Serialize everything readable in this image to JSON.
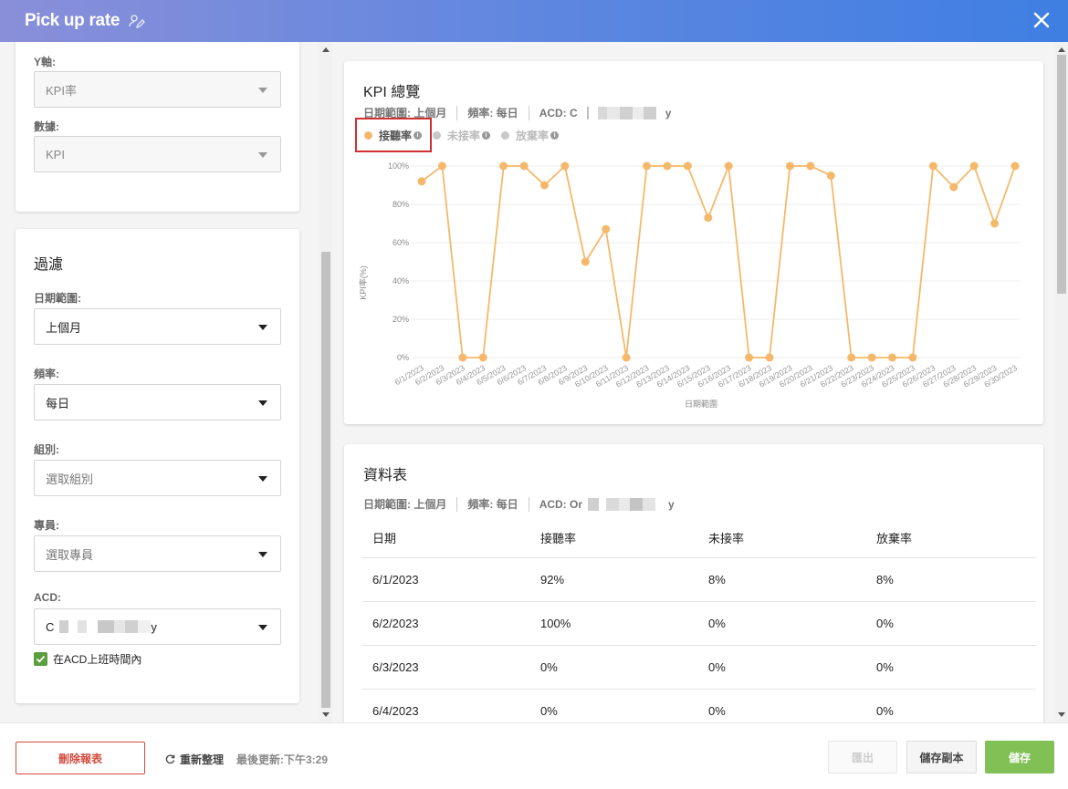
{
  "header": {
    "title": "Pick up rate"
  },
  "settings": {
    "y_axis_label": "Y軸:",
    "y_axis_value": "KPI率",
    "data_label": "數據:",
    "data_value": "KPI"
  },
  "filter": {
    "heading": "過濾",
    "date_range_label": "日期範圍:",
    "date_range_value": "上個月",
    "frequency_label": "頻率:",
    "frequency_value": "每日",
    "group_label": "組別:",
    "group_placeholder": "選取組別",
    "agent_label": "專員:",
    "agent_placeholder": "選取專員",
    "acd_label": "ACD:",
    "acd_value_start": "C",
    "acd_value_end": "y",
    "checkbox_label": "在ACD上班時間內",
    "checkbox_checked": true
  },
  "chart_card": {
    "title": "KPI 總覽",
    "meta_date": "日期範圍: 上個月",
    "meta_freq": "頻率: 每日",
    "meta_acd_prefix": "ACD: C",
    "meta_acd_suffix": "y",
    "legend": [
      {
        "label": "接聽率",
        "color": "#f5b86b",
        "active": true
      },
      {
        "label": "未接率",
        "color": "#c8c8c8",
        "active": false
      },
      {
        "label": "放棄率",
        "color": "#c8c8c8",
        "active": false
      }
    ]
  },
  "chart_data": {
    "type": "line",
    "title": "",
    "xlabel": "日期範圍",
    "ylabel": "KPI率(%)",
    "ylim": [
      0,
      100
    ],
    "yticks": [
      "0%",
      "20%",
      "40%",
      "60%",
      "80%",
      "100%"
    ],
    "color": "#f5b86b",
    "categories": [
      "6/1/2023",
      "6/2/2023",
      "6/3/2023",
      "6/4/2023",
      "6/5/2023",
      "6/6/2023",
      "6/7/2023",
      "6/8/2023",
      "6/9/2023",
      "6/10/2023",
      "6/11/2023",
      "6/12/2023",
      "6/13/2023",
      "6/14/2023",
      "6/15/2023",
      "6/16/2023",
      "6/17/2023",
      "6/18/2023",
      "6/19/2023",
      "6/20/2023",
      "6/21/2023",
      "6/22/2023",
      "6/23/2023",
      "6/24/2023",
      "6/25/2023",
      "6/26/2023",
      "6/27/2023",
      "6/28/2023",
      "6/29/2023",
      "6/30/2023"
    ],
    "series": [
      {
        "name": "接聽率",
        "values": [
          92,
          100,
          0,
          0,
          100,
          100,
          90,
          100,
          50,
          67,
          0,
          100,
          100,
          100,
          73,
          100,
          0,
          0,
          100,
          100,
          95,
          0,
          0,
          0,
          0,
          100,
          89,
          100,
          70,
          100
        ]
      }
    ]
  },
  "table_card": {
    "title": "資料表",
    "meta_date": "日期範圍: 上個月",
    "meta_freq": "頻率: 每日",
    "meta_acd_prefix": "ACD: Or",
    "meta_acd_suffix": "y",
    "columns": [
      "日期",
      "接聽率",
      "未接率",
      "放棄率"
    ],
    "rows": [
      [
        "6/1/2023",
        "92%",
        "8%",
        "8%"
      ],
      [
        "6/2/2023",
        "100%",
        "0%",
        "0%"
      ],
      [
        "6/3/2023",
        "0%",
        "0%",
        "0%"
      ],
      [
        "6/4/2023",
        "0%",
        "0%",
        "0%"
      ]
    ]
  },
  "footer": {
    "delete_label": "刪除報表",
    "refresh_label": "重新整理",
    "updated_label": "最後更新:下午3:29",
    "export_label": "匯出",
    "save_copy_label": "儲存副本",
    "save_label": "儲存"
  }
}
